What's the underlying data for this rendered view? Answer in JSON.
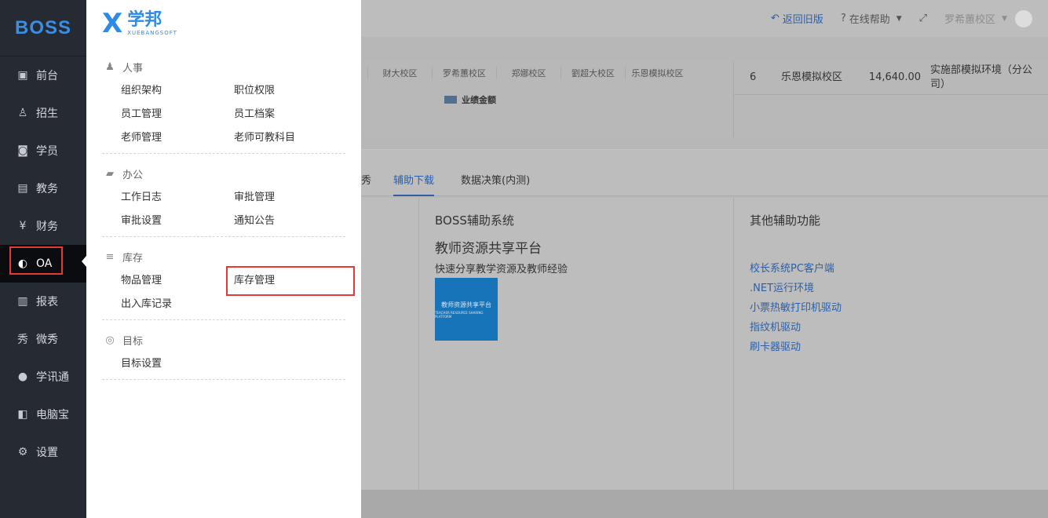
{
  "sidebar": {
    "logo": "BOSS",
    "items": [
      {
        "label": "前台",
        "icon": "calendar-icon",
        "glyph": "▣"
      },
      {
        "label": "招生",
        "icon": "add-user-icon",
        "glyph": "♙"
      },
      {
        "label": "学员",
        "icon": "id-card-icon",
        "glyph": "◙"
      },
      {
        "label": "教务",
        "icon": "book-icon",
        "glyph": "▤"
      },
      {
        "label": "财务",
        "icon": "yen-coin-icon",
        "glyph": "¥"
      },
      {
        "label": "OA",
        "icon": "chat-icon",
        "glyph": "◐",
        "active": true
      },
      {
        "label": "报表",
        "icon": "bar-chart-icon",
        "glyph": "▥"
      },
      {
        "label": "微秀",
        "icon": "xiu-icon",
        "glyph": "秀"
      },
      {
        "label": "学讯通",
        "icon": "location-pin-icon",
        "glyph": "●"
      },
      {
        "label": "电脑宝",
        "icon": "pc-icon",
        "glyph": "◧"
      },
      {
        "label": "设置",
        "icon": "gear-icon",
        "glyph": "⚙"
      }
    ]
  },
  "panel": {
    "brand": {
      "mark": "X",
      "name": "学邦",
      "sub": "XUEBANGSOFT"
    },
    "sections": [
      {
        "title": "人事",
        "icon": "person-card-icon",
        "glyph": "♟",
        "items": [
          "组织架构",
          "职位权限",
          "员工管理",
          "员工档案",
          "老师管理",
          "老师可教科目"
        ]
      },
      {
        "title": "办公",
        "icon": "briefcase-icon",
        "glyph": "▰",
        "items": [
          "工作日志",
          "审批管理",
          "审批设置",
          "通知公告"
        ]
      },
      {
        "title": "库存",
        "icon": "database-icon",
        "glyph": "≡",
        "items": [
          "物品管理",
          "库存管理",
          "出入库记录"
        ],
        "highlighted": "库存管理"
      },
      {
        "title": "目标",
        "icon": "target-icon",
        "glyph": "◎",
        "items": [
          "目标设置"
        ]
      }
    ]
  },
  "topbar": {
    "back": "返回旧版",
    "help": "在线帮助",
    "campus": "罗希蕙校区"
  },
  "background": {
    "chart_categories": [
      "财大校区",
      "罗希蕙校区",
      "郑娜校区",
      "劉超大校区",
      "乐恩模拟校区"
    ],
    "legend": "业绩金额",
    "table_row": {
      "rank": "6",
      "campus": "乐恩模拟校区",
      "amount": "14,640.00",
      "org": "实施部模拟环境（分公司）"
    },
    "tabs": [
      "秀",
      "辅助下载",
      "数据决策(内测)"
    ],
    "boss_title": "BOSS辅助系统",
    "platform_title": "教师资源共享平台",
    "platform_desc": "快速分享教学资源及教师经验",
    "thumb_title": "教师资源共享平台",
    "thumb_sub": "TEACHER RESOURCE SHARING PLATFORM",
    "other_title": "其他辅助功能",
    "links": [
      "校长系统PC客户端",
      ".NET运行环境",
      "小票热敏打印机驱动",
      "指纹机驱动",
      "刷卡器驱动"
    ]
  }
}
